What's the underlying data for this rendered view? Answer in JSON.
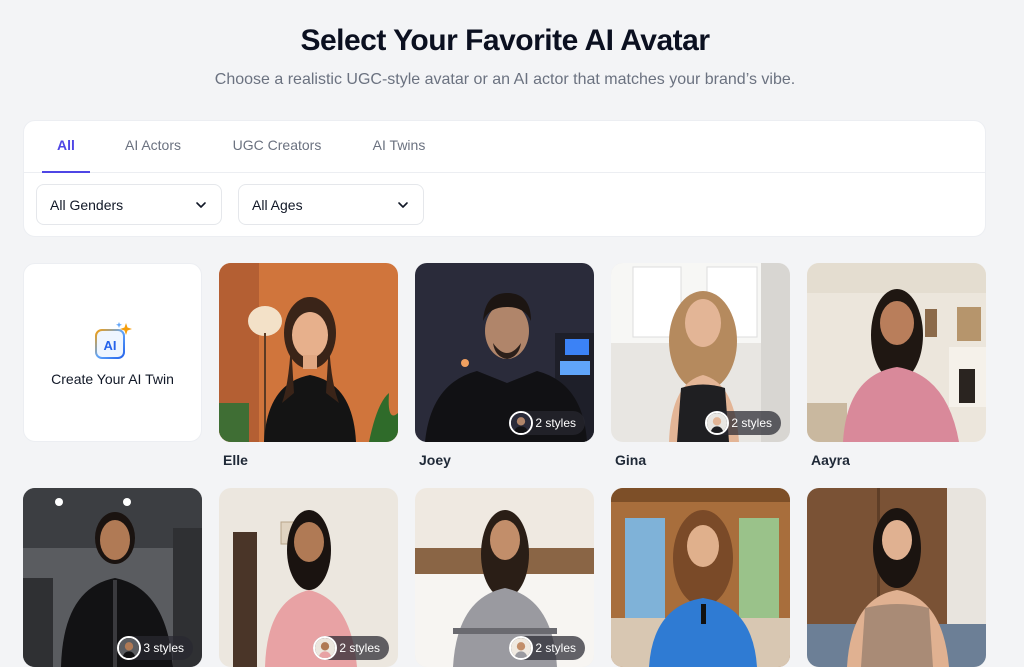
{
  "header": {
    "title": "Select Your Favorite AI Avatar",
    "subtitle": "Choose a realistic UGC-style avatar or an AI actor that matches your brand’s vibe."
  },
  "tabs": [
    {
      "label": "All",
      "active": true
    },
    {
      "label": "AI Actors",
      "active": false
    },
    {
      "label": "UGC Creators",
      "active": false
    },
    {
      "label": "AI Twins",
      "active": false
    }
  ],
  "filters": {
    "gender": "All Genders",
    "age": "All Ages"
  },
  "create_card": {
    "label": "Create Your AI Twin",
    "icon": "ai-sparkle-icon",
    "icon_text": "AI"
  },
  "avatars": [
    {
      "name": "Elle",
      "styles": ""
    },
    {
      "name": "Joey",
      "styles": "2 styles"
    },
    {
      "name": "Gina",
      "styles": "2 styles"
    },
    {
      "name": "Aayra",
      "styles": ""
    },
    {
      "name": "",
      "styles": "3 styles"
    },
    {
      "name": "",
      "styles": "2 styles"
    },
    {
      "name": "",
      "styles": "2 styles"
    },
    {
      "name": "",
      "styles": ""
    },
    {
      "name": "",
      "styles": ""
    }
  ],
  "colors": {
    "accent": "#4f46e5",
    "background": "#f3f4f6"
  }
}
